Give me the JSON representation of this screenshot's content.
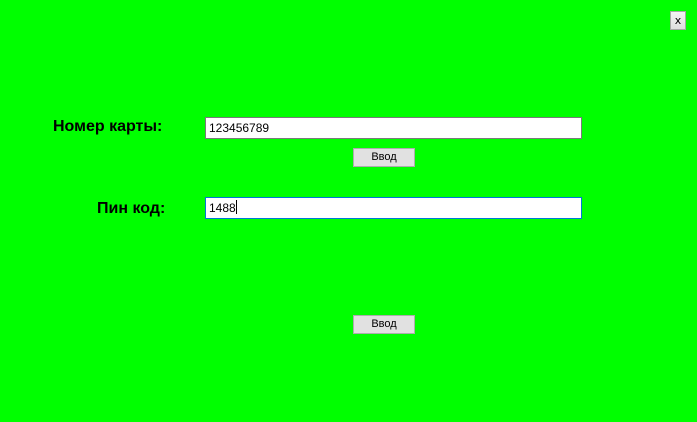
{
  "window": {
    "close_label": "x"
  },
  "card_form": {
    "card_number_label": "Номер карты:",
    "card_number_value": "123456789",
    "enter_card_button": "Ввод"
  },
  "pin_form": {
    "pin_label": "Пин код:",
    "pin_value": "1488"
  },
  "footer": {
    "submit_button": "Ввод"
  },
  "colors": {
    "background": "#00ff00",
    "focus_border": "#0078d7",
    "button_face": "#e1e1e1"
  }
}
